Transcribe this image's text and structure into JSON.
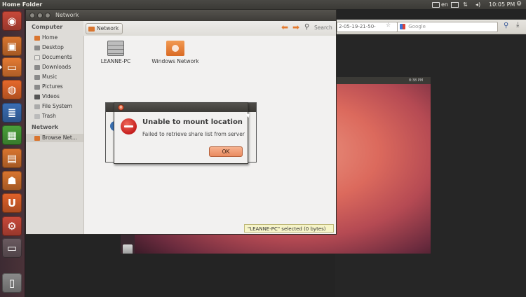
{
  "top_panel": {
    "app_title": "Home Folder",
    "keyboard_layout": "en",
    "clock": "10:05 PM",
    "tray_icons": [
      "keyboard-icon",
      "mail-icon",
      "network-icon",
      "volume-icon",
      "gear-icon"
    ]
  },
  "launcher": {
    "items": [
      {
        "name": "ubuntu-dash-icon",
        "color": "#c9493a",
        "glyph": "◉"
      },
      {
        "name": "software-center-icon",
        "color": "#d9752f",
        "glyph": "▣"
      },
      {
        "name": "files-icon",
        "color": "#e67b33",
        "glyph": "▭"
      },
      {
        "name": "firefox-icon",
        "color": "#e8692b",
        "glyph": "◍"
      },
      {
        "name": "writer-icon",
        "color": "#3b6fb6",
        "glyph": "≣"
      },
      {
        "name": "calc-icon",
        "color": "#4aa13a",
        "glyph": "▦"
      },
      {
        "name": "impress-icon",
        "color": "#d9752f",
        "glyph": "▤"
      },
      {
        "name": "ubuntu-software-icon",
        "color": "#d9752f",
        "glyph": "☗"
      },
      {
        "name": "ubuntu-one-icon",
        "color": "#e0622a",
        "glyph": "U"
      },
      {
        "name": "settings-icon",
        "color": "#c9493a",
        "glyph": "⚙"
      },
      {
        "name": "workspace-icon",
        "color": "#6a5a60",
        "glyph": "▭"
      },
      {
        "name": "trash-icon",
        "color": "#8b8b8b",
        "glyph": "▯"
      }
    ]
  },
  "browser": {
    "url": "2-05-19-21-50-",
    "search_placeholder": "Google"
  },
  "nautilus": {
    "window_title": "Network",
    "path_button": "Network",
    "search_label": "Search",
    "sidebar": {
      "computer_header": "Computer",
      "computer_items": [
        "Home",
        "Desktop",
        "Documents",
        "Downloads",
        "Music",
        "Pictures",
        "Videos",
        "File System",
        "Trash"
      ],
      "network_header": "Network",
      "network_items": [
        "Browse Net..."
      ]
    },
    "files": [
      {
        "label": "LEANNE-PC",
        "icon": "server-icon"
      },
      {
        "label": "Windows Network",
        "icon": "network-folder-icon"
      }
    ],
    "status": "\"LEANNE-PC\" selected (0 bytes)"
  },
  "vm": {
    "clock": "8:38 PM"
  },
  "dialog": {
    "title": "Unable to mount location",
    "message": "Failed to retrieve share list from server",
    "ok_label": "OK"
  }
}
